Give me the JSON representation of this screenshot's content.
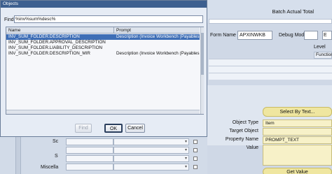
{
  "dialog": {
    "title": "Objects",
    "find_label": "Find",
    "find_value": "%inv%sum%desc%",
    "columns": [
      "Name",
      "Prompt"
    ],
    "rows": [
      {
        "name": "INV_SUM_FOLDER.DESCRIPTION",
        "prompt": "Description (Invoice Workbench (Payables Ma",
        "selected": true
      },
      {
        "name": "INV_SUM_FOLDER.APPROVAL_DESCRIPTION",
        "prompt": "",
        "selected": false
      },
      {
        "name": "INV_SUM_FOLDER.LIABILITY_DESCRIPTION",
        "prompt": "",
        "selected": false
      },
      {
        "name": "INV_SUM_FOLDER.DESCRIPTION_MIR",
        "prompt": "Description (Invoice Workbench (Payables Ma",
        "selected": false
      }
    ],
    "buttons": {
      "find": "Find",
      "ok": "OK",
      "cancel": "Cancel"
    }
  },
  "background": {
    "batch_actual_total": "Batch Actual Total",
    "form_name_label": "Form Name",
    "form_name_value": "APXINWKB",
    "debug_mode_label": "Debug Mode",
    "debug_mode_value": "E",
    "level_label": "Level",
    "function_label": "Function",
    "select_by_text": "Select By Text...",
    "object_type_label": "Object Type",
    "object_type_value": "Item",
    "target_object_label": "Target Object",
    "target_object_value": "",
    "property_name_label": "Property Name",
    "property_name_value": "PROMPT_TEXT",
    "value_label": "Value",
    "value_value": "",
    "get_value": "Get Value",
    "left_labels": [
      "Sc",
      "S",
      "Miscella"
    ]
  }
}
